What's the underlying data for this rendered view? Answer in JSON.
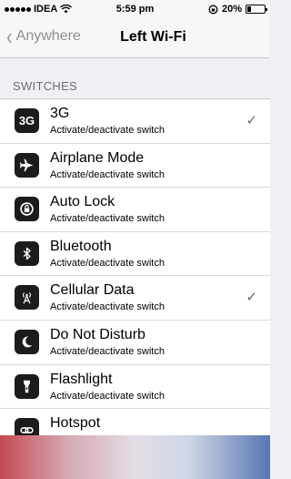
{
  "status_bar": {
    "carrier": "IDEA",
    "time": "5:59 pm",
    "battery": "20%",
    "battery_level": 0.2
  },
  "nav": {
    "back_label": "Anywhere",
    "title": "Left Wi-Fi"
  },
  "section": {
    "header": "SWITCHES"
  },
  "rows": [
    {
      "title": "3G",
      "subtitle": "Activate/deactivate switch",
      "icon": "3g-icon",
      "checked": true
    },
    {
      "title": "Airplane Mode",
      "subtitle": "Activate/deactivate switch",
      "icon": "airplane-icon",
      "checked": false
    },
    {
      "title": "Auto Lock",
      "subtitle": "Activate/deactivate switch",
      "icon": "auto-lock-icon",
      "checked": false
    },
    {
      "title": "Bluetooth",
      "subtitle": "Activate/deactivate switch",
      "icon": "bluetooth-icon",
      "checked": false
    },
    {
      "title": "Cellular Data",
      "subtitle": "Activate/deactivate switch",
      "icon": "cellular-data-icon",
      "checked": true
    },
    {
      "title": "Do Not Disturb",
      "subtitle": "Activate/deactivate switch",
      "icon": "moon-icon",
      "checked": false
    },
    {
      "title": "Flashlight",
      "subtitle": "Activate/deactivate switch",
      "icon": "flashlight-icon",
      "checked": false
    },
    {
      "title": "Hotspot",
      "subtitle": "",
      "icon": "hotspot-icon",
      "checked": false
    }
  ],
  "ui": {
    "checkmark": "✓",
    "back_chevron": "‹",
    "icon_3g_text": "3G"
  }
}
